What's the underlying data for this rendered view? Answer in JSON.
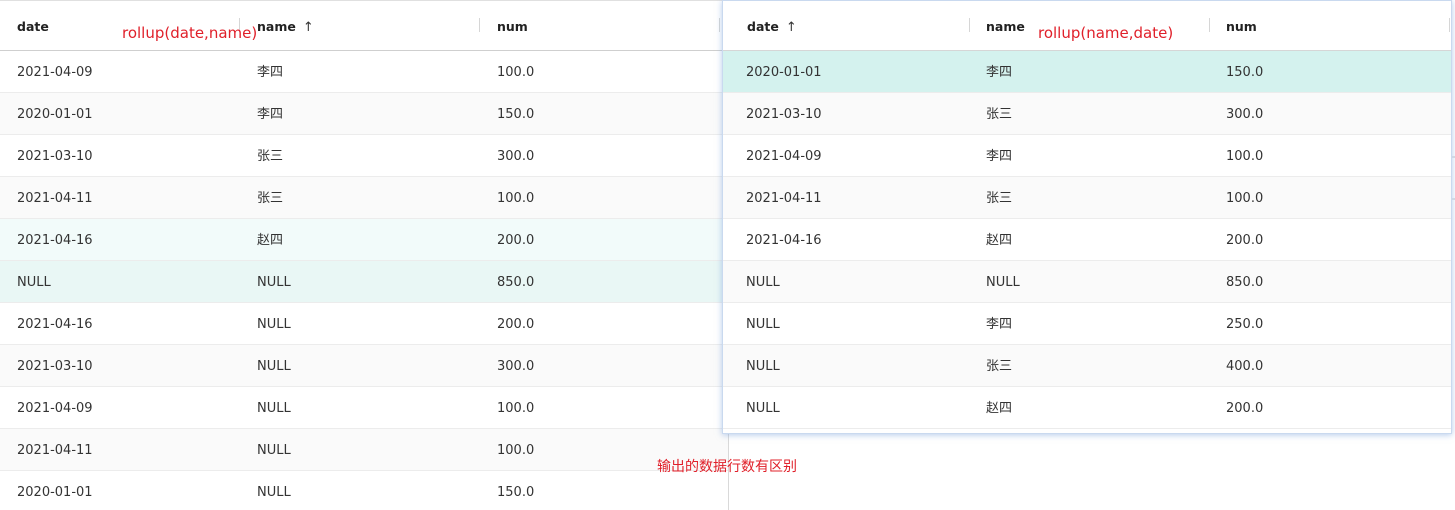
{
  "left_table": {
    "annotation": "rollup(date,name)",
    "columns": [
      {
        "label": "date",
        "sort": ""
      },
      {
        "label": "name",
        "sort": "↑"
      },
      {
        "label": "num",
        "sort": ""
      }
    ],
    "rows": [
      {
        "date": "2021-04-09",
        "name": "李四",
        "num": "100.0",
        "bg": "#ffffff"
      },
      {
        "date": "2020-01-01",
        "name": "李四",
        "num": "150.0",
        "bg": "#fafafa"
      },
      {
        "date": "2021-03-10",
        "name": "张三",
        "num": "300.0",
        "bg": "#ffffff"
      },
      {
        "date": "2021-04-11",
        "name": "张三",
        "num": "100.0",
        "bg": "#fafafa"
      },
      {
        "date": "2021-04-16",
        "name": "赵四",
        "num": "200.0",
        "bg": "#f2fbfa"
      },
      {
        "date": "NULL",
        "name": "NULL",
        "num": "850.0",
        "bg": "#e9f7f5"
      },
      {
        "date": "2021-04-16",
        "name": "NULL",
        "num": "200.0",
        "bg": "#ffffff"
      },
      {
        "date": "2021-03-10",
        "name": "NULL",
        "num": "300.0",
        "bg": "#fafafa"
      },
      {
        "date": "2021-04-09",
        "name": "NULL",
        "num": "100.0",
        "bg": "#ffffff"
      },
      {
        "date": "2021-04-11",
        "name": "NULL",
        "num": "100.0",
        "bg": "#fafafa"
      },
      {
        "date": "2020-01-01",
        "name": "NULL",
        "num": "150.0",
        "bg": "#ffffff"
      }
    ]
  },
  "right_table": {
    "annotation": "rollup(name,date)",
    "columns": [
      {
        "label": "date",
        "sort": "↑"
      },
      {
        "label": "name",
        "sort": ""
      },
      {
        "label": "num",
        "sort": ""
      }
    ],
    "rows": [
      {
        "date": "2020-01-01",
        "name": "李四",
        "num": "150.0",
        "bg": "#d4f2ee"
      },
      {
        "date": "2021-03-10",
        "name": "张三",
        "num": "300.0",
        "bg": "#fafafa"
      },
      {
        "date": "2021-04-09",
        "name": "李四",
        "num": "100.0",
        "bg": "#ffffff"
      },
      {
        "date": "2021-04-11",
        "name": "张三",
        "num": "100.0",
        "bg": "#fafafa"
      },
      {
        "date": "2021-04-16",
        "name": "赵四",
        "num": "200.0",
        "bg": "#ffffff"
      },
      {
        "date": "NULL",
        "name": "NULL",
        "num": "850.0",
        "bg": "#fafafa"
      },
      {
        "date": "NULL",
        "name": "李四",
        "num": "250.0",
        "bg": "#ffffff"
      },
      {
        "date": "NULL",
        "name": "张三",
        "num": "400.0",
        "bg": "#fafafa"
      },
      {
        "date": "NULL",
        "name": "赵四",
        "num": "200.0",
        "bg": "#ffffff"
      }
    ]
  },
  "note": "输出的数据行数有区别",
  "colors": {
    "annotation": "#e0202a",
    "selected_row": "#d4f2ee",
    "hover_row": "#e9f7f5"
  }
}
